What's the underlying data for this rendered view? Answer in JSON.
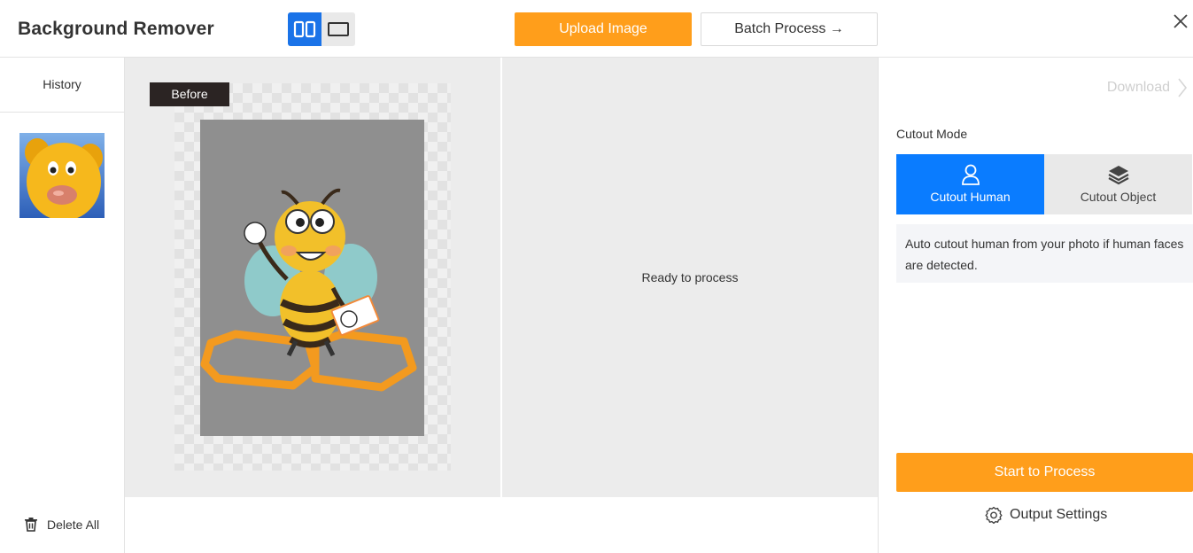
{
  "header": {
    "title": "Background Remover",
    "upload_label": "Upload Image",
    "batch_label": "Batch Process →",
    "view_modes": [
      "split-view-icon",
      "single-view-icon"
    ],
    "active_view": "split"
  },
  "sidebar": {
    "history_label": "History",
    "delete_all_label": "Delete All"
  },
  "workspace": {
    "before_label": "Before",
    "status_text": "Ready to process"
  },
  "right_panel": {
    "download_label": "Download",
    "cutout_mode_label": "Cutout Mode",
    "modes": [
      {
        "label": "Cutout Human",
        "icon": "person-icon",
        "active": true
      },
      {
        "label": "Cutout Object",
        "icon": "layers-icon",
        "active": false
      }
    ],
    "mode_description": "Auto cutout human from your photo if human faces are detected.",
    "start_label": "Start to Process",
    "output_settings_label": "Output Settings"
  },
  "colors": {
    "accent_orange": "#ff9e1b",
    "accent_blue": "#0a7cff",
    "dark_badge": "#2b2423"
  }
}
